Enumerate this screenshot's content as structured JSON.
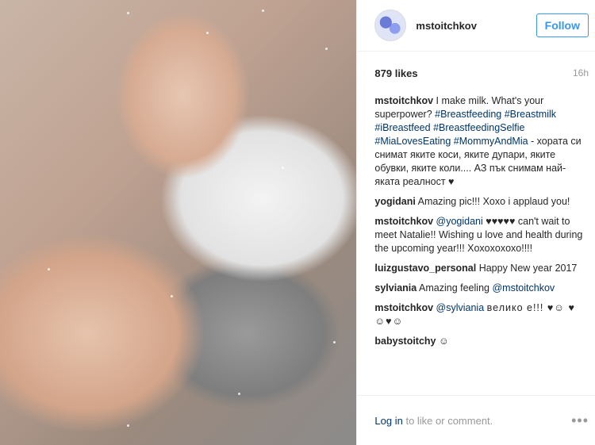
{
  "post": {
    "username": "mstoitchkov",
    "follow_label": "Follow",
    "likes": "879 likes",
    "time_ago": "16h"
  },
  "comments": [
    {
      "user": "mstoitchkov",
      "text": "I make milk. What's your superpower?",
      "tags": "#Breastfeeding #Breastmilk #iBreastfeed #BreastfeedingSelfie #MiaLovesEating #MommyAndMia",
      "tail": "- хората си снимат яките коси, яките дупари, яките обувки, яките коли.... АЗ пък снимам най-яката реалност ♥"
    },
    {
      "user": "yogidani",
      "text": "Amazing pic!!! Xoxo i applaud you!"
    },
    {
      "user": "mstoitchkov",
      "mention": "@yogidani",
      "text": "♥♥♥♥♥ can't wait to meet Natalie!! Wishing u love and health during the upcoming year!!! Xoxoxoxoxo!!!!"
    },
    {
      "user": "luizgustavo_personal",
      "text": "Happy New year 2017"
    },
    {
      "user": "sylviania",
      "text": "Amazing feeling",
      "mention": "@mstoitchkov"
    },
    {
      "user": "mstoitchkov",
      "mention": "@sylviania",
      "text": "велико е!!! ♥☺ ♥☺♥☺"
    },
    {
      "user": "babystoitchy",
      "text": "☺"
    }
  ],
  "footer": {
    "login_link": "Log in",
    "login_text": "to like or comment.",
    "more_label": "•••"
  },
  "icons": {
    "avatar": "avatar-image",
    "more": "more-options-icon"
  }
}
